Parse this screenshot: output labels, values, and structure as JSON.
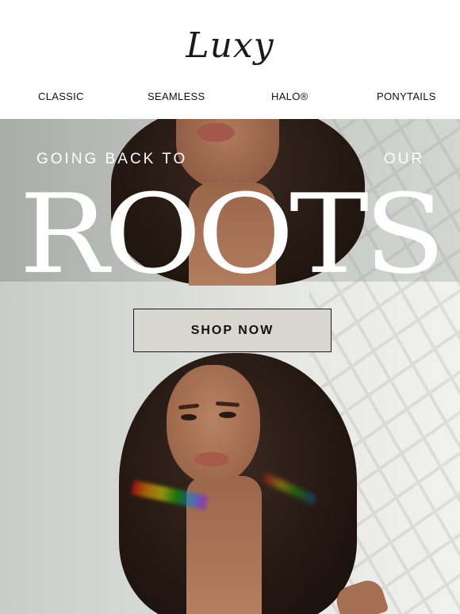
{
  "brand": {
    "logo_text": "Luxy"
  },
  "nav": {
    "items": [
      {
        "label": "CLASSIC"
      },
      {
        "label": "SEAMLESS"
      },
      {
        "label": "HALO®"
      },
      {
        "label": "PONYTAILS"
      }
    ]
  },
  "hero": {
    "kicker_left": "GOING BACK TO",
    "kicker_right": "OUR",
    "headline": "ROOTS",
    "cta_label": "SHOP NOW"
  },
  "colors": {
    "cta_background": "#d7d7d0",
    "text_dark": "#111111",
    "headline": "#ffffff"
  }
}
